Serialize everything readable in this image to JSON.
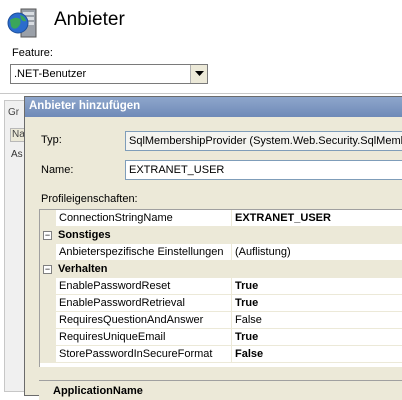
{
  "header": {
    "title": "Anbieter",
    "icon": "server-globe-icon"
  },
  "feature": {
    "label": "Feature:",
    "selected": ".NET-Benutzer"
  },
  "background": {
    "tab_label": "Gr",
    "column_label": "Na",
    "cell_label": "As"
  },
  "dialog": {
    "title": "Anbieter hinzufügen",
    "type_label": "Typ:",
    "type_value": "SqlMembershipProvider (System.Web.Security.SqlMembe",
    "name_label": "Name:",
    "name_value": "EXTRANET_USER",
    "props_label": "Profileigenschaften:",
    "desc_title": "ApplicationName"
  },
  "property_grid": {
    "top_row": {
      "name": "ConnectionStringName",
      "value": "EXTRANET_USER"
    },
    "cat_sonstiges": {
      "label": "Sonstiges",
      "expander": "−"
    },
    "row_sonstiges_1": {
      "name": "Anbieterspezifische Einstellungen",
      "value": "(Auflistung)"
    },
    "cat_verhalten": {
      "label": "Verhalten",
      "expander": "−"
    },
    "verhalten_rows": [
      {
        "name": "EnablePasswordReset",
        "value": "True"
      },
      {
        "name": "EnablePasswordRetrieval",
        "value": "True"
      },
      {
        "name": "RequiresQuestionAndAnswer",
        "value": "False"
      },
      {
        "name": "RequiresUniqueEmail",
        "value": "True"
      },
      {
        "name": "StorePasswordInSecureFormat",
        "value": "False"
      }
    ]
  },
  "colors": {
    "dialog_title": "#7791bf",
    "dialog_bg": "#ece9d8"
  }
}
